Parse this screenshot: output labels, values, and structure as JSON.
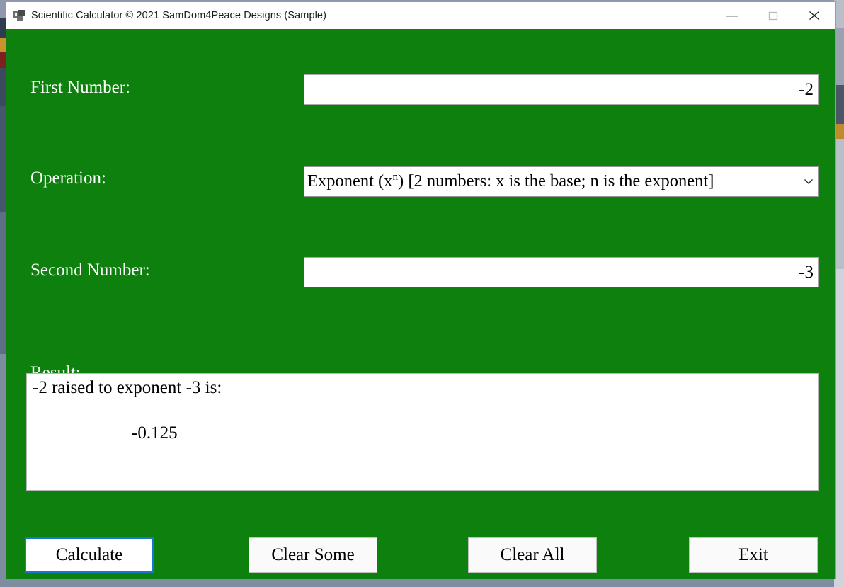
{
  "window": {
    "title": "Scientific Calculator © 2021 SamDom4Peace Designs (Sample)",
    "app_icon": "windows-forms-app-icon",
    "background_color": "#0d800d",
    "controls": {
      "minimize": "minimize-icon",
      "maximize": "maximize-icon",
      "close": "close-icon"
    }
  },
  "form": {
    "first_number": {
      "label": "First Number:",
      "value": "-2",
      "placeholder": ""
    },
    "operation": {
      "label": "Operation:",
      "selected_prefix": "Exponent (x",
      "selected_superscript": "n",
      "selected_suffix": ") [2 numbers: x is the base; n is the exponent]",
      "selected_plain": "Exponent (xⁿ) [2 numbers: x is the base; n is the exponent]",
      "arrow_icon": "chevron-down-icon"
    },
    "second_number": {
      "label": "Second Number:",
      "value": "-3",
      "placeholder": ""
    },
    "result": {
      "label": "Result:",
      "line1": "-2 raised to exponent -3 is:",
      "line2": "-0.125"
    }
  },
  "buttons": {
    "calculate": "Calculate",
    "clear_some": "Clear Some",
    "clear_all": "Clear All",
    "exit": "Exit",
    "focus_accent_color": "#1877d2"
  }
}
